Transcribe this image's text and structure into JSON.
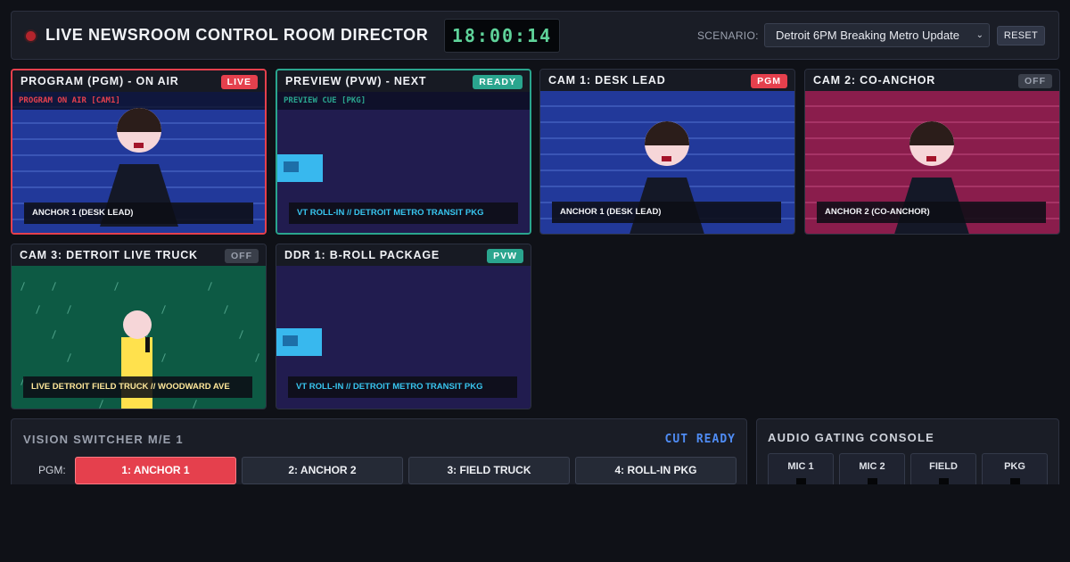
{
  "header": {
    "title": "LIVE NEWSROOM CONTROL ROOM DIRECTOR",
    "clock": "18:00:14",
    "scenario_label": "SCENARIO:",
    "scenario_value": "Detroit 6PM Breaking Metro Update",
    "reset_label": "RESET"
  },
  "monitors": {
    "program": {
      "title": "PROGRAM (PGM) - ON AIR",
      "badge": "LIVE",
      "cue": "PROGRAM ON AIR [CAM1]",
      "lower_third": "ANCHOR 1 (DESK LEAD)"
    },
    "preview": {
      "title": "PREVIEW (PVW) - NEXT",
      "badge": "READY",
      "cue": "PREVIEW CUE [PKG]",
      "lower_third": "VT ROLL-IN // DETROIT METRO TRANSIT PKG"
    },
    "cam1": {
      "title": "CAM 1: DESK LEAD",
      "badge": "PGM",
      "lower_third": "ANCHOR 1 (DESK LEAD)"
    },
    "cam2": {
      "title": "CAM 2: CO-ANCHOR",
      "badge": "OFF",
      "lower_third": "ANCHOR 2 (CO-ANCHOR)"
    },
    "cam3": {
      "title": "CAM 3: DETROIT LIVE TRUCK",
      "badge": "OFF",
      "lower_third": "LIVE DETROIT FIELD TRUCK // WOODWARD AVE"
    },
    "ddr1": {
      "title": "DDR 1: B-ROLL PACKAGE",
      "badge": "PVW",
      "lower_third": "VT ROLL-IN // DETROIT METRO TRANSIT PKG"
    }
  },
  "switcher": {
    "title": "VISION SWITCHER M/E 1",
    "status": "CUT READY",
    "row_label": "PGM:",
    "buttons": [
      "1: ANCHOR 1",
      "2: ANCHOR 2",
      "3: FIELD TRUCK",
      "4: ROLL-IN PKG"
    ],
    "active_index": 0
  },
  "audio": {
    "title": "AUDIO GATING CONSOLE",
    "channels": [
      "MIC 1",
      "MIC 2",
      "FIELD",
      "PKG"
    ]
  },
  "colors": {
    "program_accent": "#e5404d",
    "preview_accent": "#2aa58e",
    "clock_green": "#5fd39a",
    "cut_ready_blue": "#4f8cf4"
  }
}
